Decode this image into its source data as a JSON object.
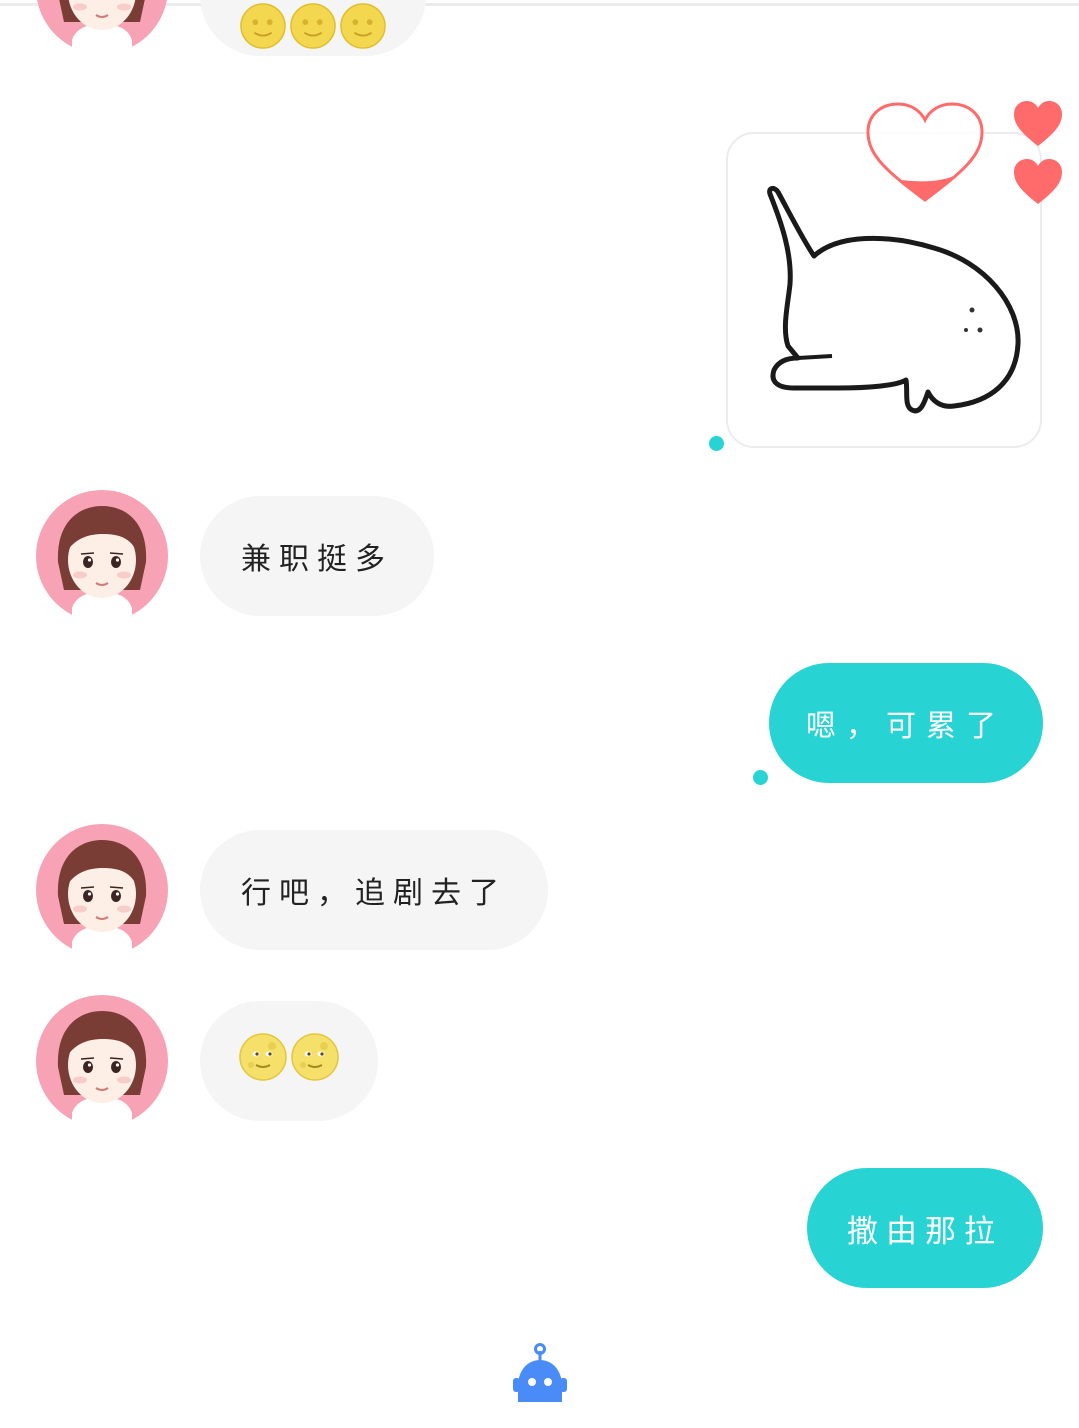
{
  "messages": [
    {
      "side": "in",
      "kind": "emoji",
      "emojis": [
        "face-emoji",
        "face-emoji",
        "face-emoji"
      ]
    },
    {
      "side": "out",
      "kind": "sticker",
      "sticker": "drawn-whale-sticker",
      "reaction": "heart-outline-icon"
    },
    {
      "side": "in",
      "kind": "text",
      "text": "兼职挺多"
    },
    {
      "side": "out",
      "kind": "text",
      "text": "嗯，可累了"
    },
    {
      "side": "in",
      "kind": "text",
      "text": "行吧，追剧去了"
    },
    {
      "side": "in",
      "kind": "emoji",
      "emojis": [
        "moon-face-emoji",
        "moon-face-emoji"
      ]
    },
    {
      "side": "out",
      "kind": "text",
      "text": "撒由那拉"
    }
  ],
  "side_icons": [
    "heart-icon",
    "heart-icon"
  ],
  "bottom_icon": "robot-assistant-icon",
  "colors": {
    "outgoing_bubble": "#27d3d3",
    "incoming_bubble": "#f5f5f5",
    "heart": "#ff6b6b",
    "robot": "#4a8cf7",
    "avatar_ring": "#f7a3b5"
  }
}
